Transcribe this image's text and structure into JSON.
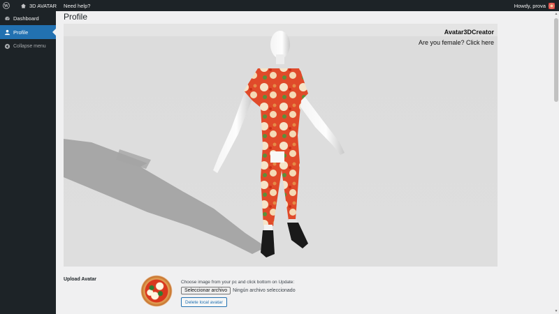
{
  "adminbar": {
    "site_name": "3D AVATAR",
    "help_link": "Need help?",
    "greeting": "Howdy, prova"
  },
  "sidebar": {
    "items": [
      {
        "label": "Dashboard",
        "icon": "dashboard-icon"
      },
      {
        "label": "Profile",
        "icon": "user-icon",
        "active": true
      },
      {
        "label": "Collapse menu",
        "icon": "collapse-icon"
      }
    ]
  },
  "page": {
    "title": "Profile"
  },
  "viewer": {
    "brand": "Avatar3DCreator",
    "female_link": "Are you female? Click here"
  },
  "upload": {
    "label": "Upload Avatar",
    "help": "Choose image from your pc and click bottom on Update:",
    "file_button": "Seleccionar archivo",
    "file_status": "Ningún archivo seleccionado",
    "delete_button": "Delete local avatar"
  },
  "colors": {
    "adminbar_bg": "#1d2327",
    "active_menu": "#2271b1",
    "page_bg": "#f0f0f1"
  }
}
